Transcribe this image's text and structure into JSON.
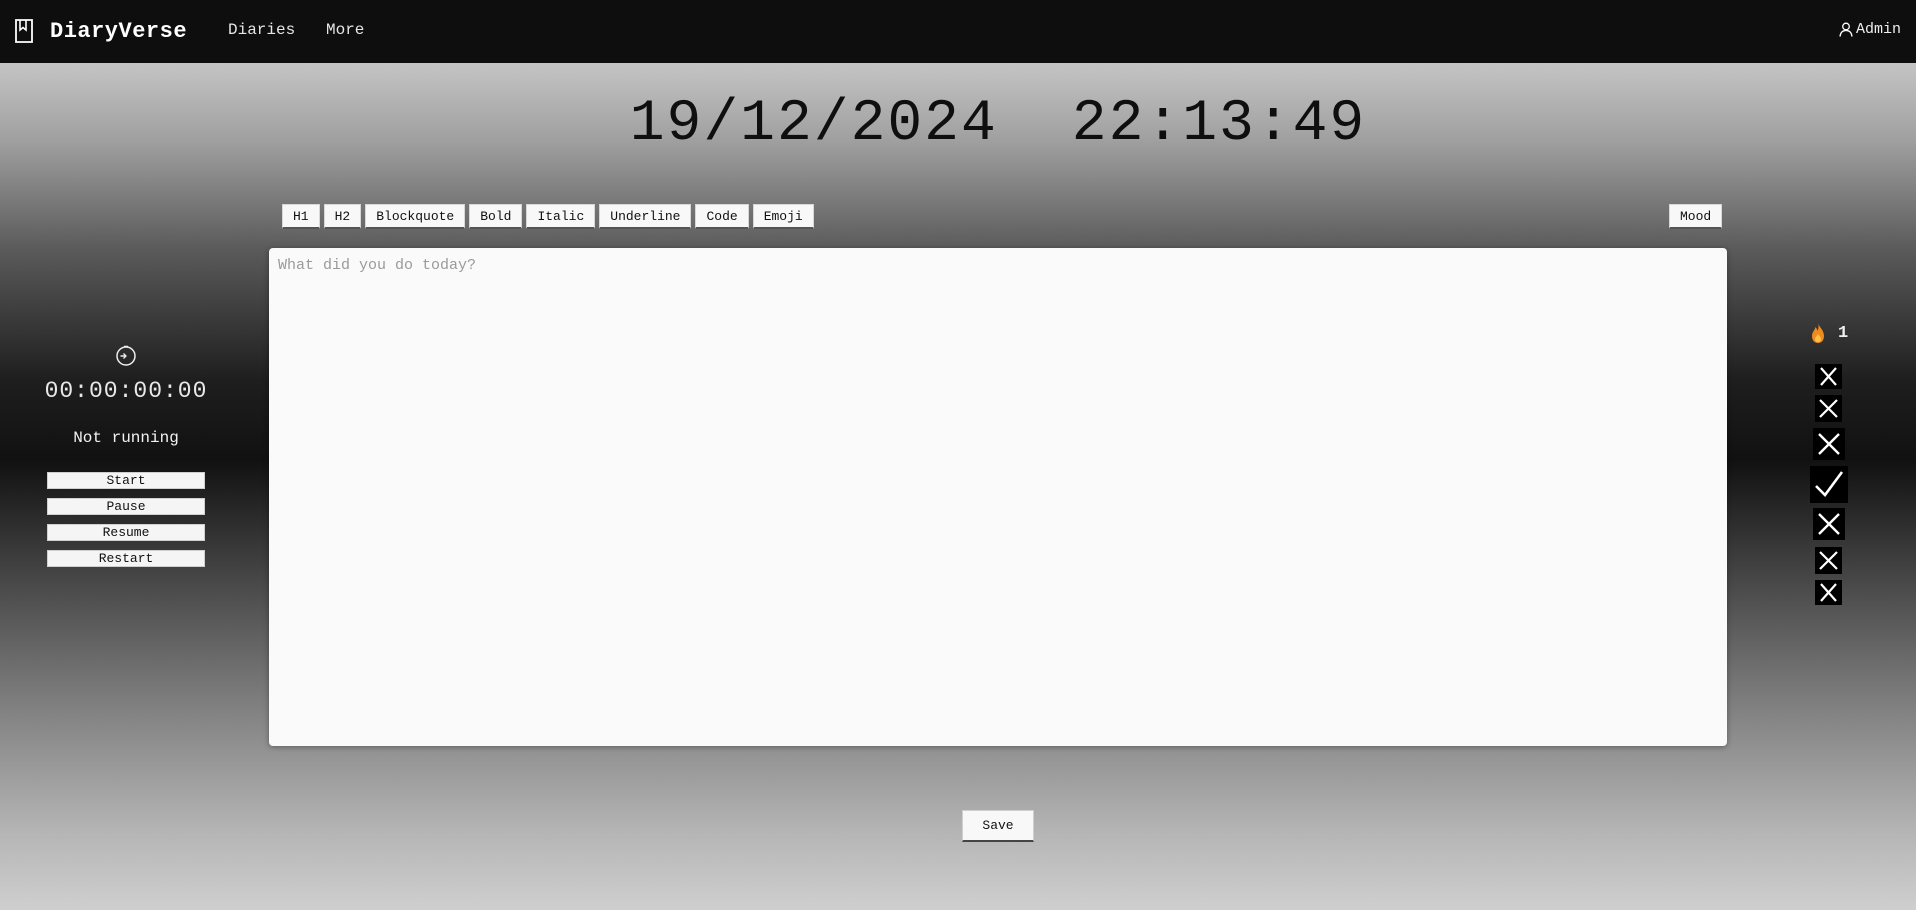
{
  "header": {
    "brand": "DiaryVerse",
    "brand_icon": "bookmark-icon",
    "nav": [
      {
        "label": "Diaries"
      },
      {
        "label": "More"
      }
    ],
    "user": {
      "label": "Admin",
      "icon": "user-icon"
    }
  },
  "clock": {
    "date": "19/12/2024",
    "time": "22:13:49"
  },
  "toolbar": {
    "buttons": [
      "H1",
      "H2",
      "Blockquote",
      "Bold",
      "Italic",
      "Underline",
      "Code",
      "Emoji"
    ],
    "mood_label": "Mood"
  },
  "editor": {
    "placeholder": "What did you do today?"
  },
  "stopwatch": {
    "icon": "timer-icon",
    "time": "00:00:00:00",
    "status": "Not running",
    "buttons": {
      "start": "Start",
      "pause": "Pause",
      "resume": "Resume",
      "restart": "Restart"
    }
  },
  "streak": {
    "icon": "flame-icon",
    "count": "1",
    "days": [
      "miss",
      "miss",
      "miss",
      "done",
      "miss",
      "miss",
      "miss"
    ]
  },
  "save_label": "Save",
  "colors": {
    "navbar": "#0e0e0e",
    "flame": "#f08a1c",
    "editor_bg": "#fafafa"
  }
}
